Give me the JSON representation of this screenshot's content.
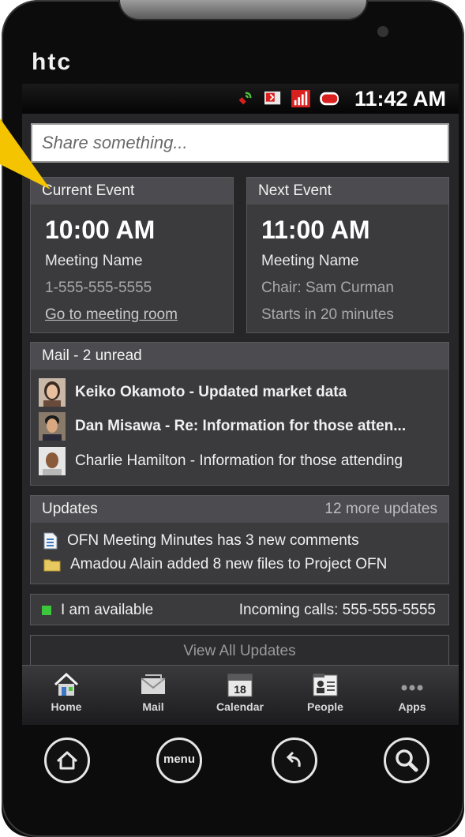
{
  "device": {
    "brand": "htc"
  },
  "status_bar": {
    "time": "11:42 AM",
    "icons": [
      "phone-signal-icon",
      "message-icon",
      "signal-bars-icon",
      "battery-icon"
    ]
  },
  "share": {
    "placeholder": "Share something..."
  },
  "current_event": {
    "header": "Current Event",
    "time": "10:00 AM",
    "name": "Meeting Name",
    "phone": "1-555-555-5555",
    "link": "Go to meeting room"
  },
  "next_event": {
    "header": "Next Event",
    "time": "11:00 AM",
    "name": "Meeting Name",
    "chair": "Chair: Sam Curman",
    "starts": "Starts in 20 minutes"
  },
  "mail": {
    "header": "Mail - 2 unread",
    "items": [
      {
        "text": "Keiko Okamoto - Updated market data",
        "unread": true
      },
      {
        "text": "Dan Misawa - Re: Information for those atten...",
        "unread": true
      },
      {
        "text": "Charlie Hamilton - Information for those attending",
        "unread": false
      }
    ]
  },
  "updates": {
    "header": "Updates",
    "more": "12 more updates",
    "items": [
      {
        "icon": "document-icon",
        "text": "OFN Meeting Minutes has 3 new comments"
      },
      {
        "icon": "folder-icon",
        "text": "Amadou Alain added 8 new files to Project OFN"
      }
    ]
  },
  "presence": {
    "status": "I am available",
    "status_color": "#3cc63c",
    "incoming": "Incoming calls: 555-555-5555"
  },
  "view_all": "View All Updates",
  "nav": {
    "items": [
      {
        "label": "Home",
        "icon": "home-icon"
      },
      {
        "label": "Mail",
        "icon": "mail-icon"
      },
      {
        "label": "Calendar",
        "icon": "calendar-icon",
        "badge": "18"
      },
      {
        "label": "People",
        "icon": "people-icon"
      },
      {
        "label": "Apps",
        "icon": "apps-icon"
      }
    ]
  },
  "hardware_buttons": {
    "menu_label": "menu"
  },
  "colors": {
    "pointer": "#f5c400",
    "card_bg": "#3b3b3e",
    "card_header": "#4c4c50"
  }
}
